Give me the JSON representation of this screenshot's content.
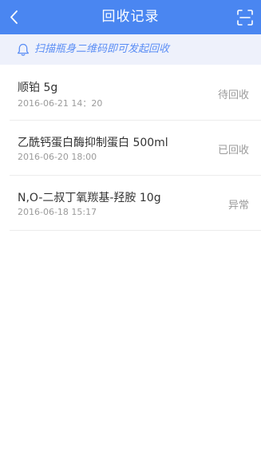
{
  "header": {
    "title": "回收记录",
    "back_icon": "chevron-left-icon",
    "scan_icon": "scan-frame-icon",
    "background": "#4a86f1"
  },
  "hint": {
    "icon": "bell-icon",
    "text": "扫描瓶身二维码即可发起回收",
    "color": "#5b8ef5"
  },
  "records": [
    {
      "name": "顺铂  5g",
      "time": "2016-06-21  14：20",
      "status": "待回收"
    },
    {
      "name": "乙酰钙蛋白酶抑制蛋白  500ml",
      "time": "2016-06-20  18:00",
      "status": "已回收"
    },
    {
      "name": "N,O-二叔丁氧羰基-羟胺  10g",
      "time": "2016-06-18  15:17",
      "status": "异常"
    }
  ]
}
